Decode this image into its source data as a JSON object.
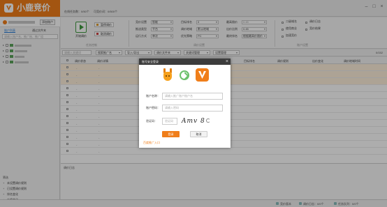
{
  "app": {
    "title": "小鹿竞价"
  },
  "titlebar": {
    "stat1": "在线任务数：0/50个",
    "stat2": "可竞价词：0/500个"
  },
  "sidebar": {
    "add_account": "添加账户",
    "tabs": [
      "账户列表",
      "通过文件夹"
    ],
    "search_placeholder": "请输入账户名、推广账、推广组",
    "filter_title": "筛选",
    "filters": [
      "未设置调价规则",
      "已设置调价规则",
      "排名变化",
      "价格变化"
    ]
  },
  "toolbar": {
    "start_label": "开始调价",
    "pause_label": "暂停调价",
    "cancel_label": "取消调价",
    "group_run": "任务控制",
    "group_adjust": "调价设置",
    "group_account": "账户设置",
    "settings": {
      "rank_mode_label": "竞价设置",
      "rank_mode_value": "智能",
      "push_mode_label": "推送类型",
      "push_mode_value": "平台",
      "run_mode_label": "运行方式",
      "run_mode_value": "单次",
      "target_rank_label": "目标排名",
      "target_rank_value": "0",
      "region_label": "调价地域",
      "region_value": "默认地域",
      "device_label": "优先策略",
      "device_value": "PC",
      "max_price_label": "最高限价",
      "max_price_value": "0.45",
      "step_label": "出价比例",
      "step_value": "",
      "interval_label": "最低价格",
      "interval_value": "0.45",
      "site_label": "最终排名",
      "site_value": "根据最高价限价"
    },
    "options": [
      "二级域名",
      "调价日志",
      "使用商业",
      "竞价结果",
      "加速竞价"
    ]
  },
  "filterbar": {
    "search_placeholder": "请输入关键词",
    "selects": [
      "搜索推广名",
      "导入/导出",
      "调价文件夹",
      "关键词管理",
      "设置管理"
    ],
    "count": "0/152"
  },
  "table": {
    "headers": [
      "调价状态",
      "调价详情",
      "目标排名",
      "调价规则",
      "出价变化",
      "调价地域时间"
    ],
    "rows": [
      {
        "highlight": true,
        "status": "-",
        "detail": "-"
      },
      {
        "highlight": true,
        "status": "-",
        "detail": "-"
      },
      {
        "highlight": true,
        "status": "-",
        "detail": "-"
      },
      {
        "highlight": false,
        "status": "-",
        "detail": "-"
      },
      {
        "highlight": false,
        "status": "-",
        "detail": "-"
      },
      {
        "highlight": false,
        "status": "-",
        "detail": "-"
      },
      {
        "highlight": false,
        "status": "-",
        "detail": "-"
      },
      {
        "highlight": false,
        "status": "-",
        "detail": "-"
      },
      {
        "highlight": false,
        "status": "-",
        "detail": "-"
      },
      {
        "highlight": false,
        "status": "-",
        "detail": "-"
      },
      {
        "highlight": false,
        "status": "-",
        "detail": "-"
      },
      {
        "highlight": false,
        "status": "-",
        "detail": "-"
      },
      {
        "highlight": false,
        "status": "-",
        "detail": "-"
      }
    ],
    "bottom_label": "调价日志"
  },
  "statusbar": {
    "items": [
      "竞价版本",
      "调价日志：0/0个",
      "任务队列：0/0个"
    ]
  },
  "modal": {
    "title": "账号安全登录",
    "account_label": "账户名称：",
    "account_placeholder": "请输入推广账户账户名",
    "password_label": "账户密码：",
    "password_placeholder": "请输入密码",
    "captcha_label": "验证码：",
    "captcha_placeholder": "验证码",
    "captcha_text": "Amv 8",
    "login_label": "登录",
    "cancel_label": "取消",
    "link_label": "百度推广入口"
  },
  "colors": {
    "brand": "#f07e1a",
    "accent": "#2a7ed8",
    "highlight_row": "#fff0dc"
  }
}
